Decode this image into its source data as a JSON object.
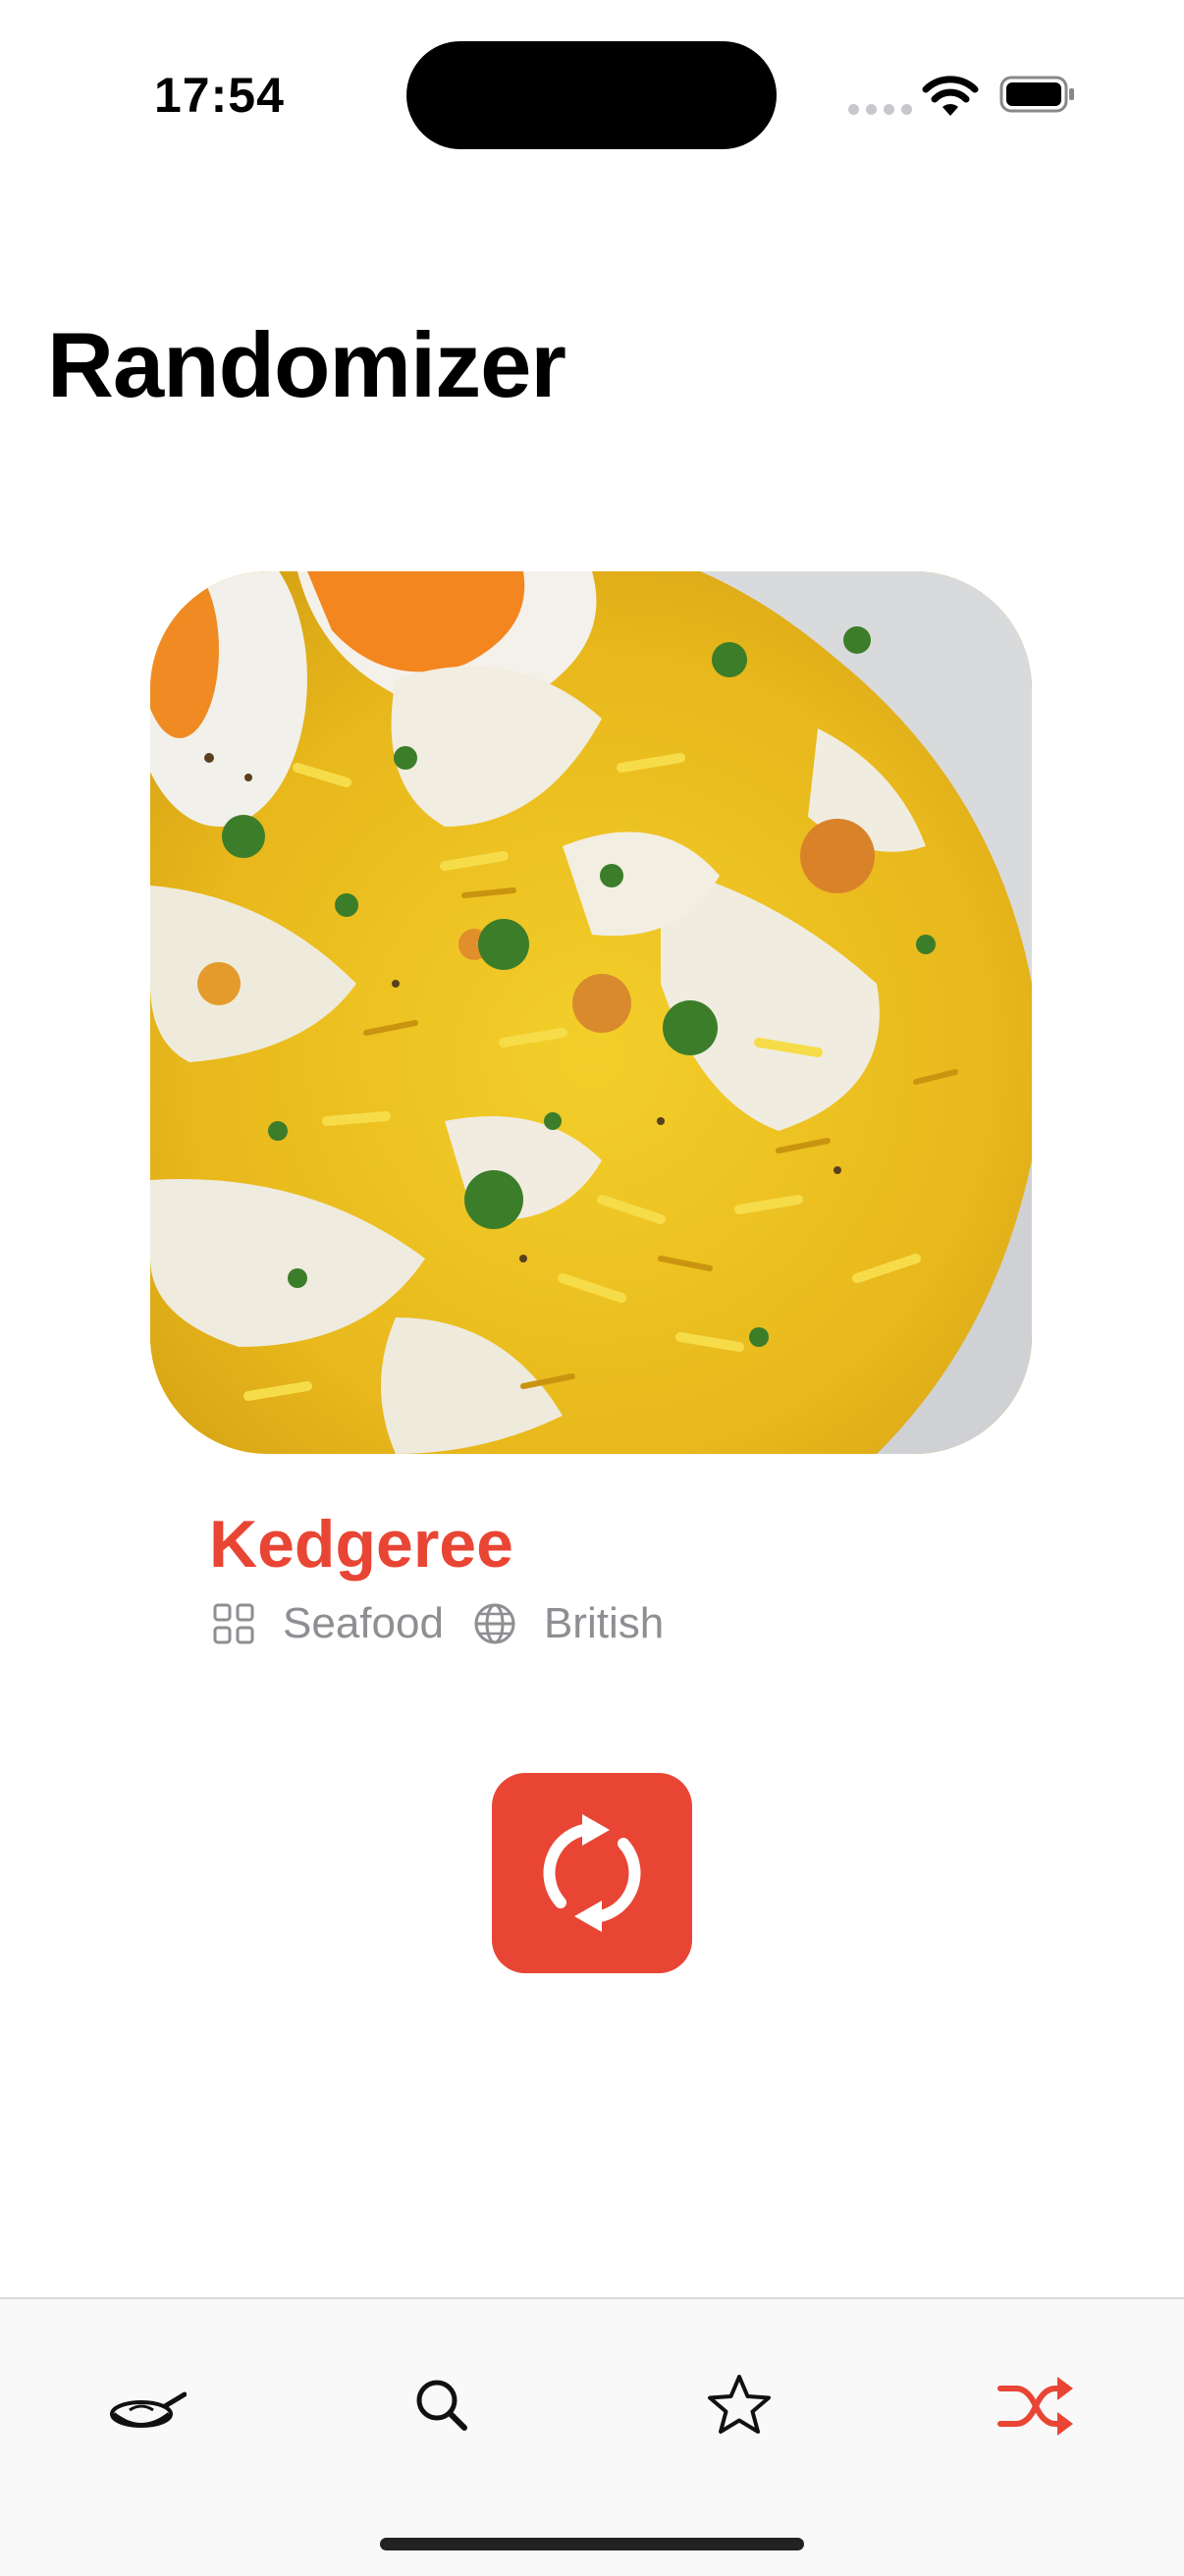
{
  "status_bar": {
    "time": "17:54"
  },
  "page": {
    "title": "Randomizer"
  },
  "recipe": {
    "name": "Kedgeree",
    "category": "Seafood",
    "cuisine": "British",
    "image_icon": "kedgeree-photo"
  },
  "actions": {
    "refresh_icon": "refresh-icon"
  },
  "tab_bar": {
    "tabs": [
      {
        "icon": "frying-pan-icon",
        "selected": false
      },
      {
        "icon": "search-icon",
        "selected": false
      },
      {
        "icon": "star-icon",
        "selected": false
      },
      {
        "icon": "shuffle-icon",
        "selected": true
      }
    ]
  },
  "colors": {
    "accent": "#e94534",
    "secondary_text": "#8e8e93"
  }
}
